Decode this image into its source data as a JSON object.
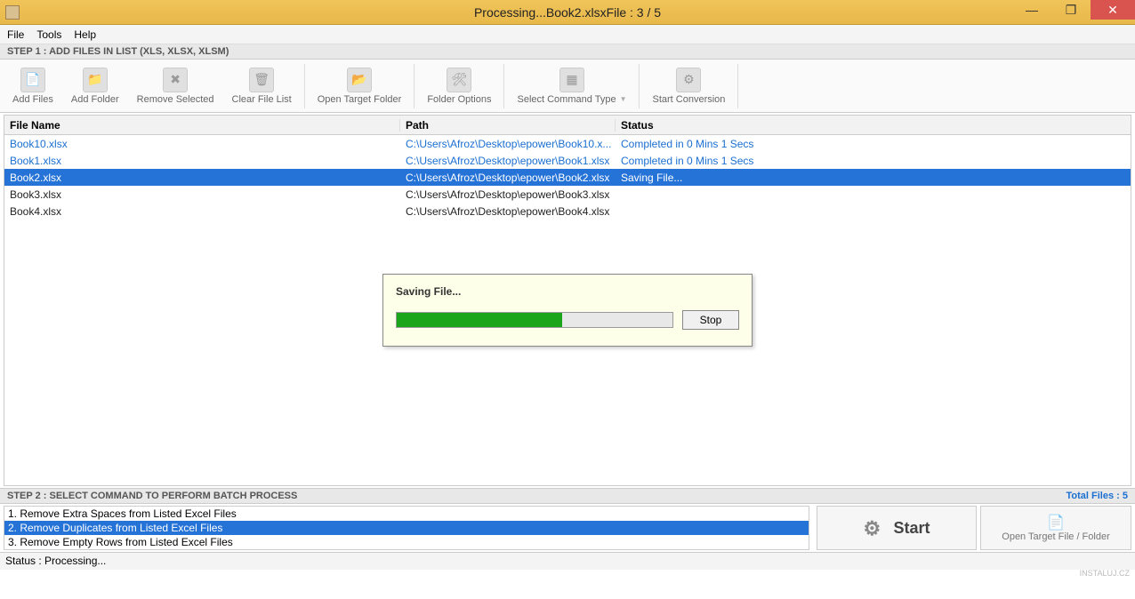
{
  "window": {
    "title": "Processing...Book2.xlsxFile : 3 / 5"
  },
  "menu": {
    "file": "File",
    "tools": "Tools",
    "help": "Help"
  },
  "step1": {
    "header": "STEP 1 : ADD FILES IN LIST (XLS, XLSX, XLSM)"
  },
  "toolbar": {
    "add_files": "Add Files",
    "add_folder": "Add Folder",
    "remove_selected": "Remove Selected",
    "clear_list": "Clear File List",
    "open_target": "Open Target Folder",
    "folder_options": "Folder Options",
    "select_command": "Select Command Type",
    "start_conversion": "Start Conversion"
  },
  "table": {
    "headers": {
      "file": "File Name",
      "path": "Path",
      "status": "Status"
    },
    "rows": [
      {
        "file": "Book10.xlsx",
        "path": "C:\\Users\\Afroz\\Desktop\\epower\\Book10.x...",
        "status": "Completed in 0 Mins 1 Secs",
        "state": "completed"
      },
      {
        "file": "Book1.xlsx",
        "path": "C:\\Users\\Afroz\\Desktop\\epower\\Book1.xlsx",
        "status": "Completed in 0 Mins 1 Secs",
        "state": "completed"
      },
      {
        "file": "Book2.xlsx",
        "path": "C:\\Users\\Afroz\\Desktop\\epower\\Book2.xlsx",
        "status": "Saving File...",
        "state": "selected"
      },
      {
        "file": "Book3.xlsx",
        "path": "C:\\Users\\Afroz\\Desktop\\epower\\Book3.xlsx",
        "status": "",
        "state": "normal"
      },
      {
        "file": "Book4.xlsx",
        "path": "C:\\Users\\Afroz\\Desktop\\epower\\Book4.xlsx",
        "status": "",
        "state": "normal"
      }
    ]
  },
  "step2": {
    "header": "STEP 2 : SELECT COMMAND TO PERFORM BATCH PROCESS",
    "total_label": "Total Files : 5"
  },
  "commands": [
    {
      "text": "1. Remove Extra Spaces from Listed Excel Files",
      "selected": false
    },
    {
      "text": "2. Remove Duplicates from Listed Excel Files",
      "selected": true
    },
    {
      "text": "3. Remove Empty Rows from Listed Excel Files",
      "selected": false
    }
  ],
  "buttons": {
    "start": "Start",
    "open_target_folder": "Open Target File / Folder"
  },
  "statusbar": "Status  :  Processing...",
  "dialog": {
    "label": "Saving File...",
    "stop": "Stop",
    "progress_percent": 60
  },
  "watermark": "INSTALUJ.CZ"
}
